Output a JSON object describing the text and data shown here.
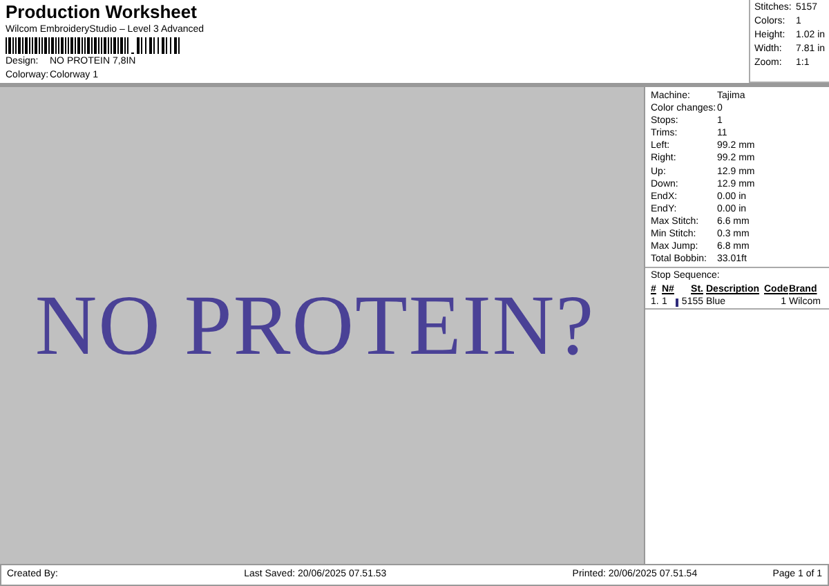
{
  "title": "Production Worksheet",
  "subtitle": "Wilcom EmbroideryStudio – Level 3 Advanced",
  "info": [
    {
      "label": "Design:",
      "value": "NO PROTEIN 7,8IN"
    },
    {
      "label": "Colorway:",
      "value": "Colorway 1"
    }
  ],
  "summary": [
    {
      "label": "Stitches:",
      "value": "5157"
    },
    {
      "label": "Colors:",
      "value": "1"
    },
    {
      "label": "Height:",
      "value": "1.02 in"
    },
    {
      "label": "Width:",
      "value": "7.81 in"
    },
    {
      "label": "Zoom:",
      "value": "1:1"
    }
  ],
  "design_text": "NO PROTEIN?",
  "details": [
    {
      "label": "Machine:",
      "value": "Tajima"
    },
    {
      "label": "Color changes:",
      "value": "0"
    },
    {
      "label": "Stops:",
      "value": "1"
    },
    {
      "label": "Trims:",
      "value": "11"
    },
    {
      "label": "Left:",
      "value": "99.2 mm"
    },
    {
      "label": "Right:",
      "value": "99.2 mm"
    },
    {
      "label": "Up:",
      "value": "12.9 mm"
    },
    {
      "label": "Down:",
      "value": "12.9 mm"
    },
    {
      "label": "EndX:",
      "value": "0.00 in"
    },
    {
      "label": "EndY:",
      "value": "0.00 in"
    },
    {
      "label": "Max Stitch:",
      "value": "6.6 mm"
    },
    {
      "label": "Min Stitch:",
      "value": "0.3 mm"
    },
    {
      "label": "Max Jump:",
      "value": "6.8 mm"
    },
    {
      "label": "Total Bobbin:",
      "value": "33.01ft"
    }
  ],
  "stop_sequence": {
    "title": "Stop Sequence:",
    "columns": [
      "#",
      "N#",
      "St.",
      "Description",
      "Code",
      "Brand"
    ],
    "rows": [
      {
        "number": "1.",
        "needle": "1",
        "color": "#2e2a7a",
        "stitches": "5155",
        "description": "Blue",
        "code": "1",
        "brand": "Wilcom"
      }
    ]
  },
  "footer": {
    "created": "Created By:",
    "saved": "Last Saved: 20/06/2025 07.51.53",
    "printed": "Printed: 20/06/2025 07.51.54",
    "page": "Page 1 of 1"
  }
}
